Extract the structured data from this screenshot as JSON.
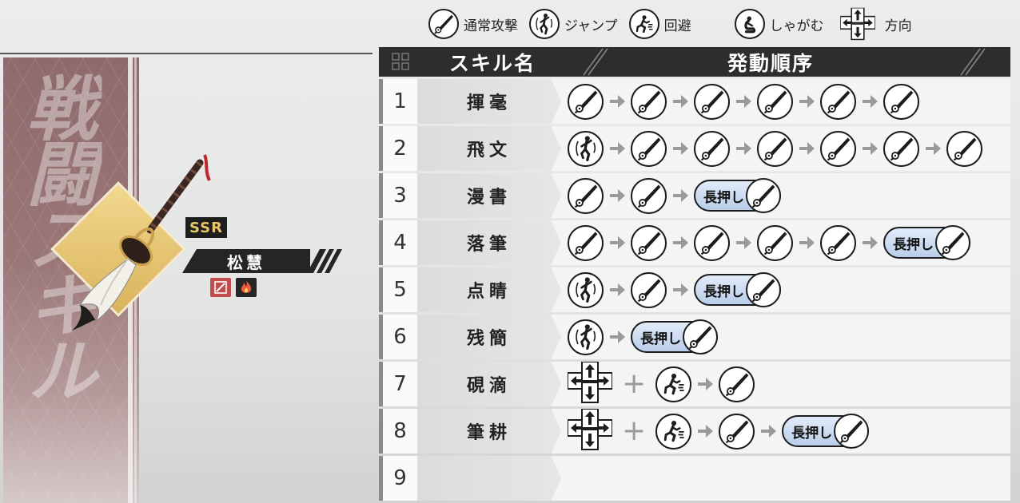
{
  "legend": [
    {
      "icon": "normal-attack-icon",
      "label": "通常攻撃"
    },
    {
      "icon": "jump-icon",
      "label": "ジャンプ"
    },
    {
      "icon": "dodge-icon",
      "label": "回避"
    },
    {
      "icon": "crouch-icon",
      "label": "しゃがむ"
    },
    {
      "icon": "direction-pad-icon",
      "label": "方向"
    }
  ],
  "banner": {
    "title": "戦闘スキル"
  },
  "weapon": {
    "rarity": "SSR",
    "name": "松慧",
    "elements": [
      "slash-element-icon",
      "fire-element-icon"
    ]
  },
  "table": {
    "header": {
      "skill_name": "スキル名",
      "order": "発動順序"
    },
    "hold_label": "長押し",
    "rows": [
      {
        "num": "1",
        "name": "揮毫",
        "seq": [
          "atk",
          "atk",
          "atk",
          "atk",
          "atk",
          "atk"
        ]
      },
      {
        "num": "2",
        "name": "飛文",
        "seq": [
          "jump",
          "atk",
          "atk",
          "atk",
          "atk",
          "atk",
          "atk"
        ]
      },
      {
        "num": "3",
        "name": "漫書",
        "seq": [
          "atk",
          "atk",
          "hold"
        ]
      },
      {
        "num": "4",
        "name": "落筆",
        "seq": [
          "atk",
          "atk",
          "atk",
          "atk",
          "atk",
          "hold"
        ]
      },
      {
        "num": "5",
        "name": "点睛",
        "seq": [
          "jump",
          "atk",
          "hold"
        ]
      },
      {
        "num": "6",
        "name": "残簡",
        "seq": [
          "jump",
          "hold"
        ]
      },
      {
        "num": "7",
        "name": "硯滴",
        "seq": [
          "dir",
          "+",
          "dodge",
          "atk"
        ]
      },
      {
        "num": "8",
        "name": "筆耕",
        "seq": [
          "dir",
          "+",
          "dodge",
          "atk",
          "hold"
        ]
      },
      {
        "num": "9",
        "name": "",
        "seq": []
      }
    ]
  },
  "colors": {
    "header_bg": "#2d2d2d",
    "banner": "#9a7677",
    "hold_bg": "#c6d6ee",
    "rarity_text": "#e8c667"
  }
}
